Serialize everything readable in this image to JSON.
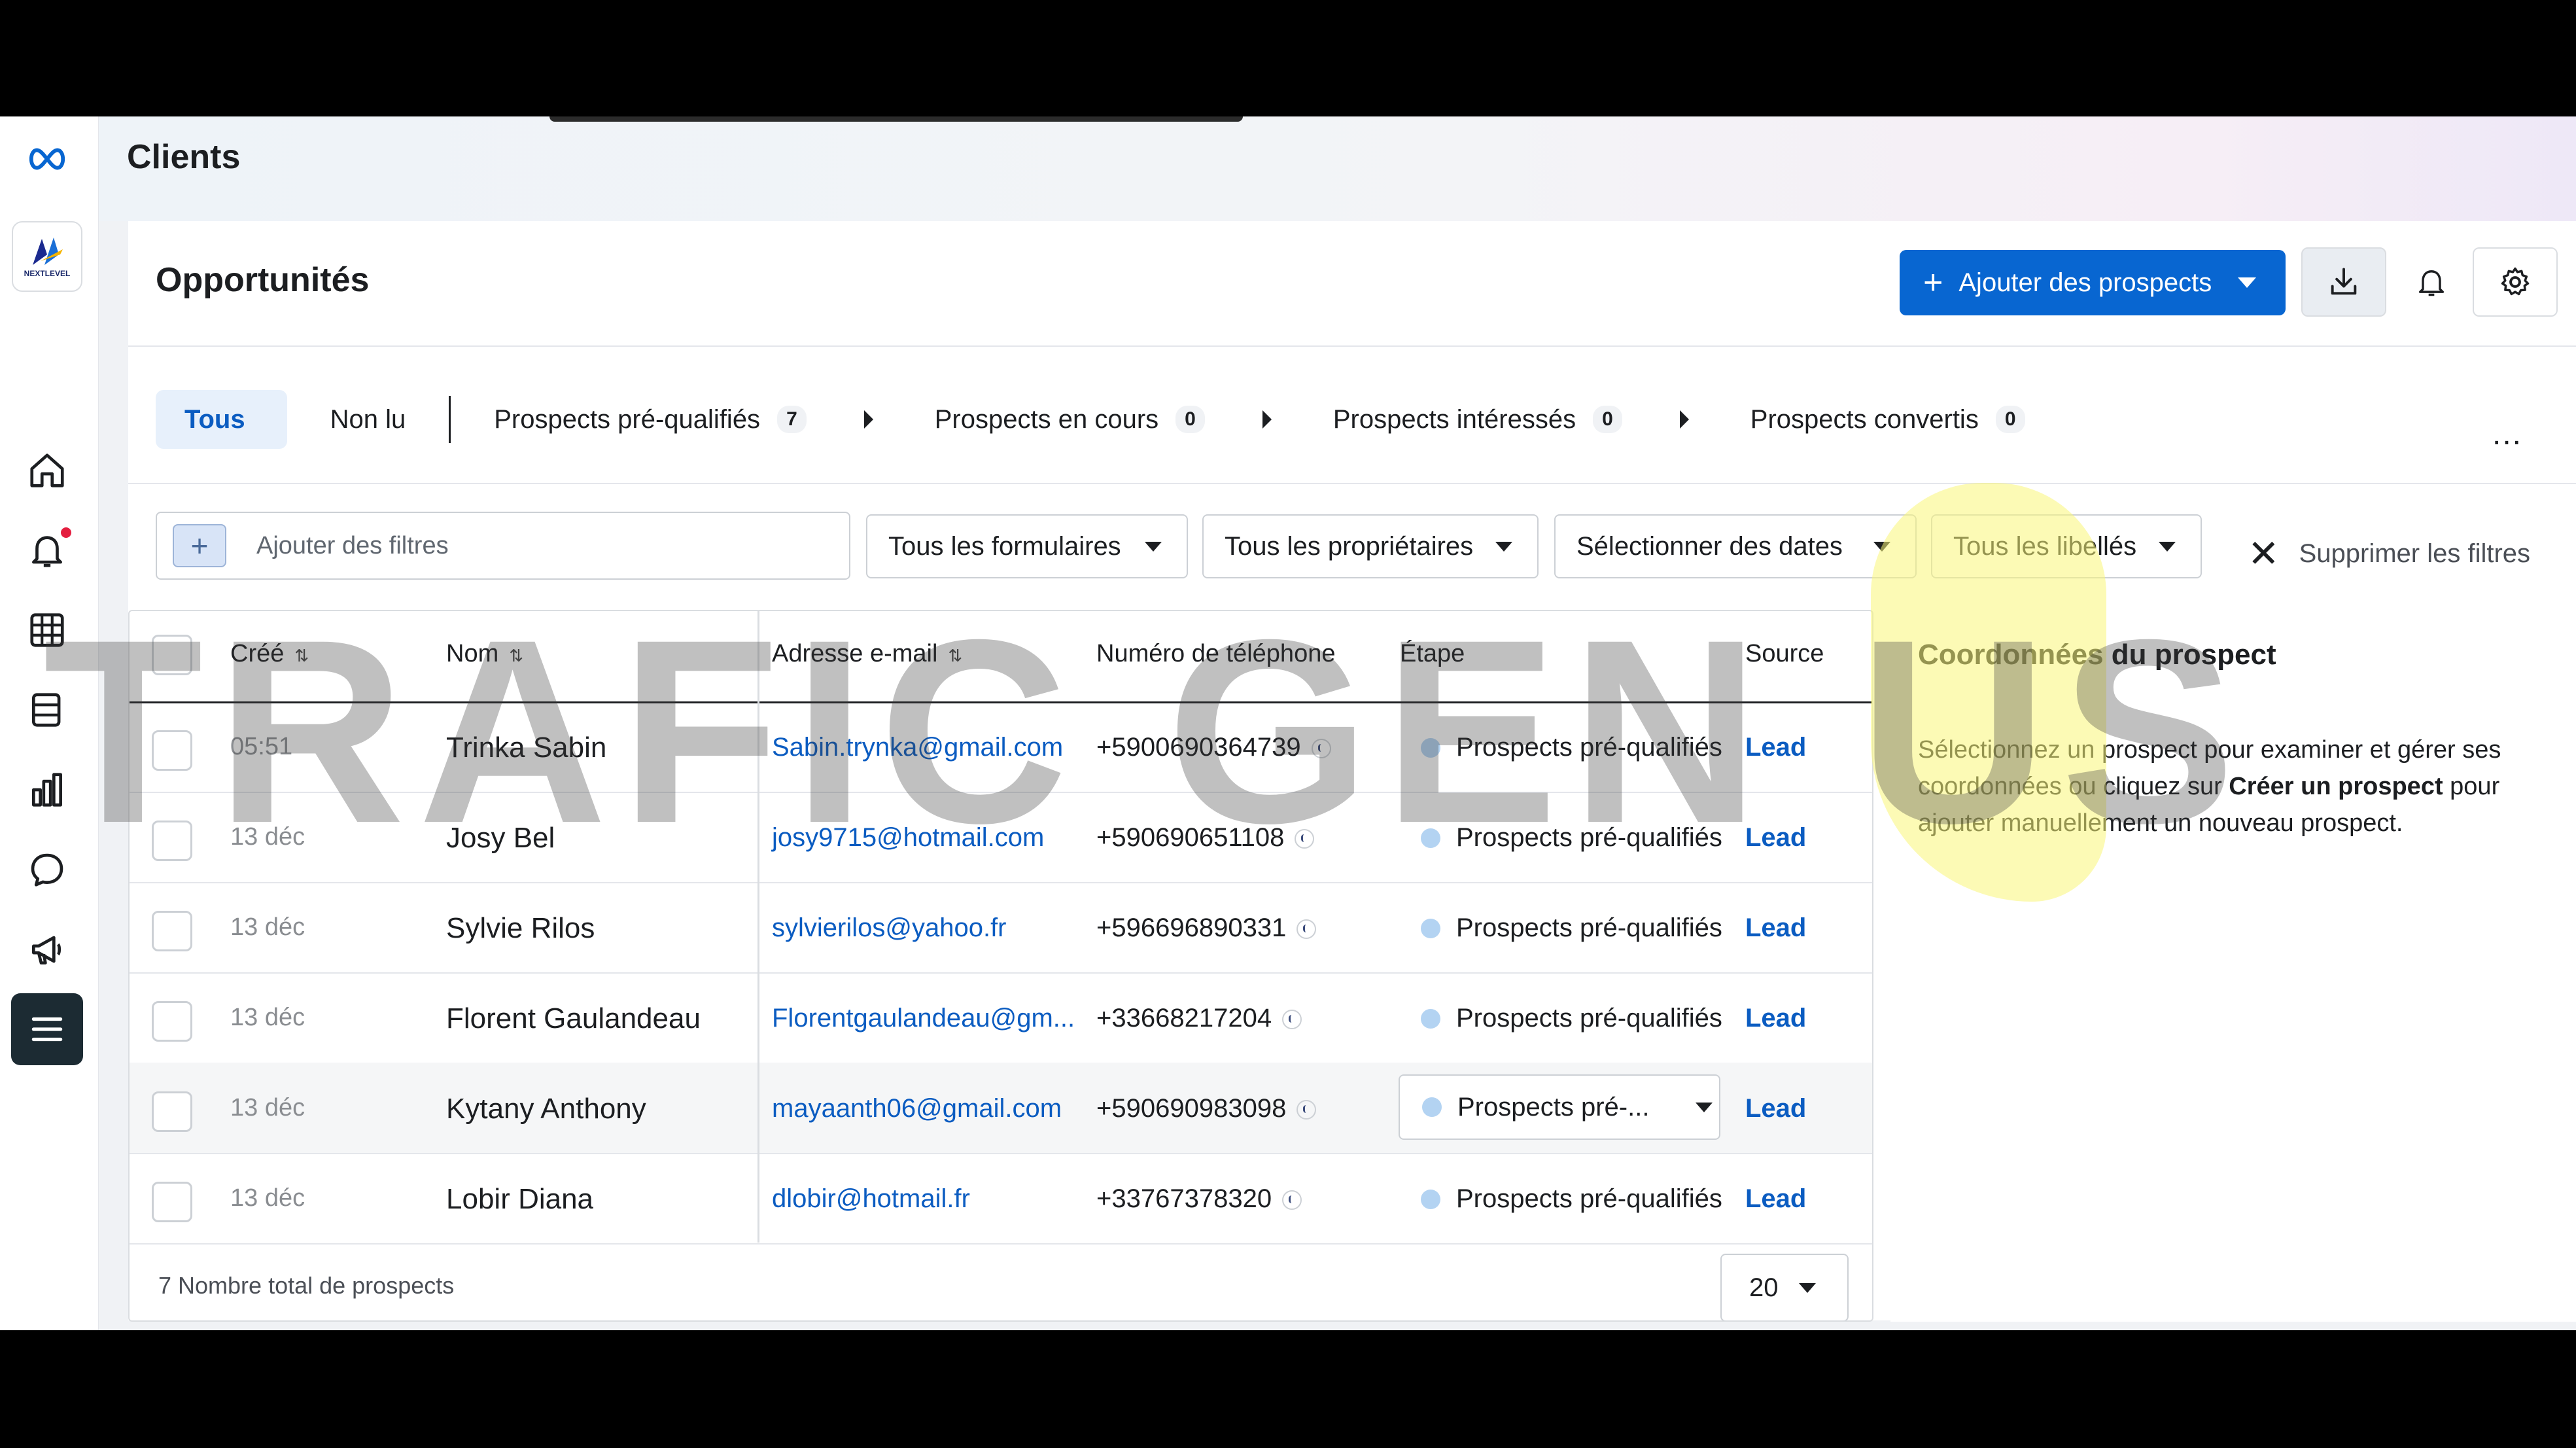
{
  "header": {
    "title": "Clients"
  },
  "panel": {
    "title": "Opportunités",
    "add_button": "Ajouter des prospects"
  },
  "tabs": {
    "all": "Tous",
    "unread": "Non lu",
    "items": [
      {
        "label": "Prospects pré-qualifiés",
        "count": "7"
      },
      {
        "label": "Prospects en cours",
        "count": "0"
      },
      {
        "label": "Prospects intéressés",
        "count": "0"
      },
      {
        "label": "Prospects convertis",
        "count": "0"
      }
    ],
    "more": "..."
  },
  "filters": {
    "add_placeholder": "Ajouter des filtres",
    "forms": "Tous les formulaires",
    "owners": "Tous les propriétaires",
    "dates": "Sélectionner des dates",
    "labels": "Tous les libellés",
    "clear": "Supprimer les filtres"
  },
  "table": {
    "headers": {
      "created": "Créé",
      "name": "Nom",
      "email": "Adresse e-mail",
      "phone": "Numéro de téléphone",
      "stage": "Étape",
      "source": "Source"
    },
    "rows": [
      {
        "created": "05:51",
        "name": "Trinka Sabin",
        "email": "Sabin.trynka@gmail.com",
        "phone": "+5900690364739",
        "stage": "Prospects pré-qualifiés",
        "source": "Lead"
      },
      {
        "created": "13 déc",
        "name": "Josy Bel",
        "email": "josy9715@hotmail.com",
        "phone": "+590690651108",
        "stage": "Prospects pré-qualifiés",
        "source": "Lead"
      },
      {
        "created": "13 déc",
        "name": "Sylvie Rilos",
        "email": "sylvierilos@yahoo.fr",
        "phone": "+596696890331",
        "stage": "Prospects pré-qualifiés",
        "source": "Lead"
      },
      {
        "created": "13 déc",
        "name": "Florent Gaulandeau",
        "email": "Florentgaulandeau@gm...",
        "phone": "+33668217204",
        "stage": "Prospects pré-qualifiés",
        "source": "Lead"
      },
      {
        "created": "13 déc",
        "name": "Kytany Anthony",
        "email": "mayaanth06@gmail.com",
        "phone": "+590690983098",
        "stage": "Prospects pré-...",
        "source": "Lead"
      },
      {
        "created": "13 déc",
        "name": "Lobir Diana",
        "email": "dlobir@hotmail.fr",
        "phone": "+33767378320",
        "stage": "Prospects pré-qualifiés",
        "source": "Lead"
      }
    ],
    "total": "7 Nombre total de prospects",
    "page_size": "20"
  },
  "details": {
    "title": "Coordonnées du prospect",
    "text_before": "Sélectionnez un prospect pour examiner et gérer ses coordonnées ou cliquez sur ",
    "text_bold": "Créer un prospect",
    "text_after": " pour ajouter manuellement un nouveau prospect."
  },
  "logo_text": "NEXTLEVEL",
  "watermark": "TRAFIC GEN  US",
  "colors": {
    "accent": "#0866d1",
    "link": "#0b5cc1",
    "stage_dot": "#b3d3f2",
    "notification": "#e41e3f"
  }
}
